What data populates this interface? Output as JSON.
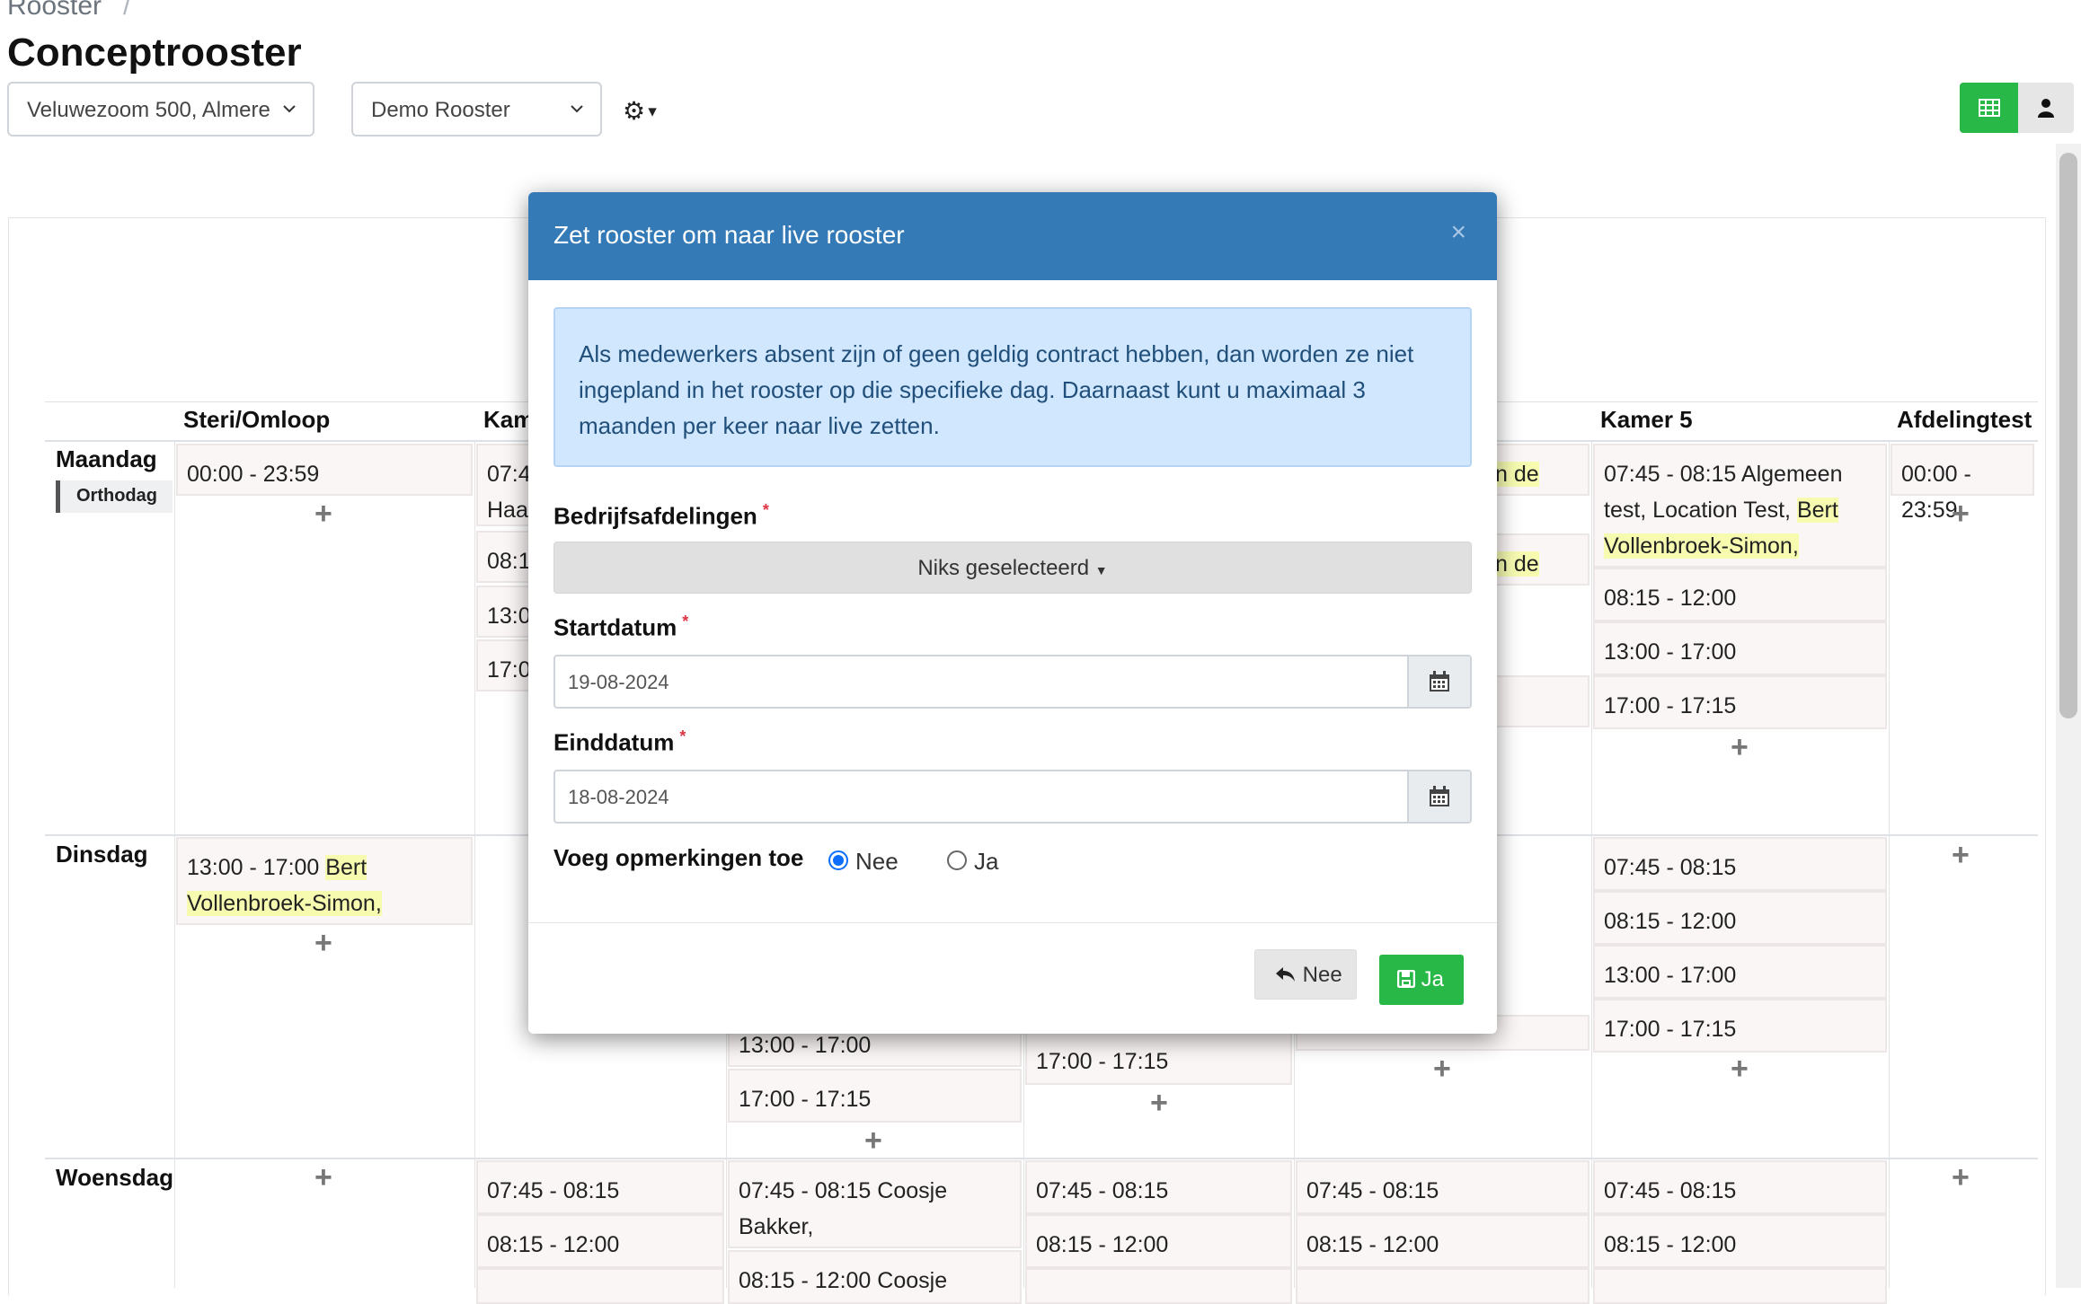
{
  "breadcrumb": {
    "parent": "Rooster",
    "separator": "/"
  },
  "page_title": "Conceptrooster",
  "filters": {
    "location": "Veluwezoom 500, Almere",
    "schedule": "Demo Rooster"
  },
  "columns": {
    "steri": "Steri/Omloop",
    "kamer_partial": "Kam",
    "kamer5": "Kamer 5",
    "afdelingtest": "Afdelingtest"
  },
  "days": {
    "maandag": "Maandag",
    "orthodag": "Orthodag",
    "dinsdag": "Dinsdag",
    "woensdag": "Woensdag"
  },
  "cells": {
    "steri_ma": "00:00 - 23:59",
    "steri_di_time": "13:00 - 17:00",
    "steri_di_name1": "Bert",
    "steri_di_name2": "Vollenbroek-Simon,",
    "k_ma_1": "07:4",
    "k_ma_1b": "Haa",
    "k_ma_2": "08:1",
    "k_ma_3": "13:0",
    "k_ma_4": "17:0",
    "hl_partial_1": "n de",
    "hl_partial_2": "n de",
    "k5_ma_1a": "07:45 - 08:15 Algemeen",
    "k5_ma_1b": "test, Location Test,",
    "k5_ma_1c": "Bert",
    "k5_ma_1d": "Vollenbroek-Simon,",
    "k5_ma_2": "08:15 - 12:00",
    "k5_ma_3": "13:00 - 17:00",
    "k5_ma_4": "17:00 - 17:15",
    "af_ma": "00:00 - 23:59",
    "k5_di_1": "07:45 - 08:15",
    "k5_di_2": "08:15 - 12:00",
    "k5_di_3": "13:00 - 17:00",
    "k5_di_4": "17:00 - 17:15",
    "c2_di_3": "13:00 - 17:00",
    "c2_di_4": "17:00 - 17:15",
    "c3_di_4": "17:00 - 17:15",
    "wo_c1_1": "07:45 - 08:15",
    "wo_c1_2": "08:15 - 12:00",
    "wo_c2_1a": "07:45 - 08:15 Coosje",
    "wo_c2_1b": "Bakker,",
    "wo_c2_2": "08:15 - 12:00 Coosje",
    "wo_c3_1": "07:45 - 08:15",
    "wo_c3_2": "08:15 - 12:00",
    "wo_c4_1": "07:45 - 08:15",
    "wo_c4_2": "08:15 - 12:00",
    "wo_c5_1": "07:45 - 08:15",
    "wo_c5_2": "08:15 - 12:00"
  },
  "modal": {
    "title": "Zet rooster om naar live rooster",
    "close": "×",
    "alert": "Als medewerkers absent zijn of geen geldig contract hebben, dan worden ze niet ingepland in het rooster op die specifieke dag. Daarnaast kunt u maximaal 3 maanden per keer naar live zetten.",
    "departments_label": "Bedrijfsafdelingen",
    "departments_value": "Niks geselecteerd",
    "start_label": "Startdatum",
    "start_value": "19-08-2024",
    "end_label": "Einddatum",
    "end_value": "18-08-2024",
    "remarks_label": "Voeg opmerkingen toe",
    "radio_no": "Nee",
    "radio_yes": "Ja",
    "btn_no": "Nee",
    "btn_yes": "Ja",
    "required_mark": "*"
  },
  "colors": {
    "primary": "#337ab7",
    "success": "#28b847",
    "highlight": "#f6fbb0"
  },
  "icons": [
    "chevron-down-icon",
    "gear-icon",
    "table-icon",
    "user-icon",
    "calendar-icon",
    "undo-icon",
    "save-icon",
    "plus-icon",
    "close-icon"
  ]
}
